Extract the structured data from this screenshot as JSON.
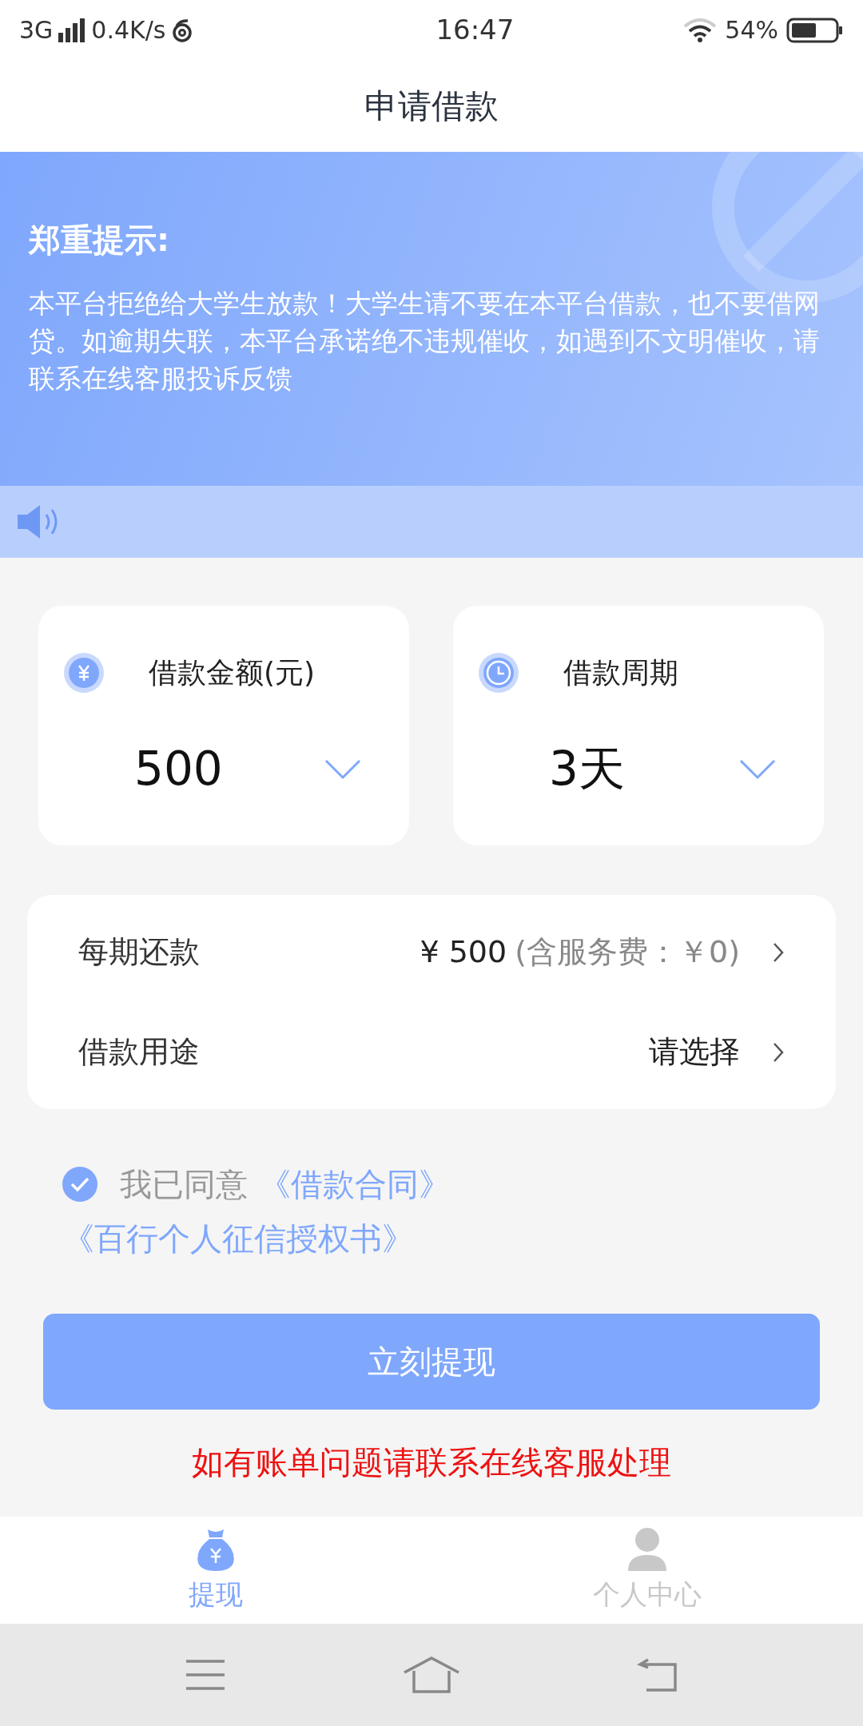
{
  "status_bar": {
    "network": "3G",
    "speed": "0.4K/s",
    "time": "16:47",
    "battery": "54%"
  },
  "header": {
    "title": "申请借款"
  },
  "notice": {
    "title": "郑重提示:",
    "body": "本平台拒绝给大学生放款！大学生请不要在本平台借款，也不要借网贷。如逾期失联，本平台承诺绝不违规催收，如遇到不文明催收，请联系在线客服投诉反馈"
  },
  "pickers": [
    {
      "kind": "amount",
      "label": "借款金额(元)",
      "value": "500"
    },
    {
      "kind": "period",
      "label": "借款周期",
      "value": "3天"
    }
  ],
  "rows": [
    {
      "label": "每期还款",
      "value": "¥ 500",
      "note": "(含服务费：￥0)"
    },
    {
      "label": "借款用途",
      "value": "请选择"
    }
  ],
  "agreement": {
    "checked": true,
    "text": "我已同意",
    "links": [
      "《借款合同》",
      "《百行个人征信授权书》"
    ]
  },
  "submit_button": "立刻提现",
  "footer_note": "如有账单问题请联系在线客服处理",
  "tab_bar": [
    {
      "kind": "withdraw",
      "label": "提现",
      "selected": true
    },
    {
      "kind": "profile",
      "label": "个人中心",
      "selected": false
    }
  ]
}
